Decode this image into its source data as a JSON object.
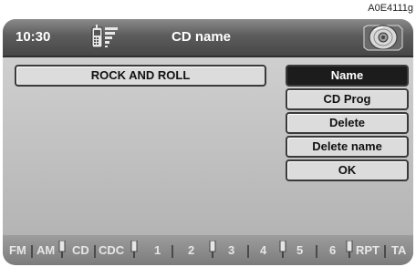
{
  "figure_code": "A0E4111g",
  "header": {
    "time": "10:30",
    "title": "CD name",
    "phone_icon": "phone-signal-icon",
    "cd_icon": "cd-disc-icon"
  },
  "name_field": {
    "value": "ROCK AND ROLL"
  },
  "menu": {
    "items": [
      {
        "label": "Name",
        "active": true
      },
      {
        "label": "CD Prog",
        "active": false
      },
      {
        "label": "Delete",
        "active": false
      },
      {
        "label": "Delete name",
        "active": false
      },
      {
        "label": "OK",
        "active": false
      }
    ]
  },
  "footer": {
    "sources": [
      "FM",
      "AM",
      "CD",
      "CDC",
      "1",
      "2",
      "3",
      "4",
      "5",
      "6",
      "RPT",
      "TA"
    ]
  },
  "colors": {
    "header": "#5c5c5c",
    "screen_bg": "#bcbcbc",
    "active_button": "#1c1c1c",
    "button": "#dcdcdc"
  }
}
